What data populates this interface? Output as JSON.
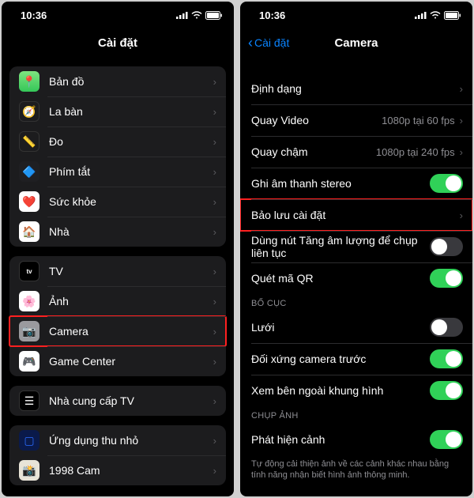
{
  "status": {
    "time": "10:36"
  },
  "left": {
    "title": "Cài đặt",
    "groups": [
      {
        "items": [
          {
            "icon": "maps-icon",
            "label": "Bản đồ"
          },
          {
            "icon": "compass-icon",
            "label": "La bàn"
          },
          {
            "icon": "measure-icon",
            "label": "Đo"
          },
          {
            "icon": "shortcuts-icon",
            "label": "Phím tắt"
          },
          {
            "icon": "health-icon",
            "label": "Sức khỏe"
          },
          {
            "icon": "home-icon",
            "label": "Nhà"
          }
        ]
      },
      {
        "items": [
          {
            "icon": "tv-icon",
            "label": "TV"
          },
          {
            "icon": "photos-icon",
            "label": "Ảnh"
          },
          {
            "icon": "camera-icon",
            "label": "Camera",
            "highlight": true
          },
          {
            "icon": "gamecenter-icon",
            "label": "Game Center"
          }
        ]
      },
      {
        "items": [
          {
            "icon": "tvprovider-icon",
            "label": "Nhà cung cấp TV"
          }
        ]
      },
      {
        "items": [
          {
            "icon": "widget-icon",
            "label": "Ứng dụng thu nhỏ"
          },
          {
            "icon": "cam1998-icon",
            "label": "1998 Cam"
          }
        ]
      }
    ]
  },
  "right": {
    "back": "Cài đặt",
    "title": "Camera",
    "section1": [
      {
        "label": "Định dạng",
        "type": "nav"
      },
      {
        "label": "Quay Video",
        "detail": "1080p tại 60 fps",
        "type": "nav"
      },
      {
        "label": "Quay chậm",
        "detail": "1080p tại 240 fps",
        "type": "nav"
      },
      {
        "label": "Ghi âm thanh stereo",
        "type": "toggle",
        "on": true
      },
      {
        "label": "Bảo lưu cài đặt",
        "type": "nav",
        "highlight": true
      },
      {
        "label": "Dùng nút Tăng âm lượng để chụp liên tục",
        "type": "toggle",
        "on": false
      },
      {
        "label": "Quét mã QR",
        "type": "toggle",
        "on": true
      }
    ],
    "section2_header": "BỐ CỤC",
    "section2": [
      {
        "label": "Lưới",
        "type": "toggle",
        "on": false
      },
      {
        "label": "Đối xứng camera trước",
        "type": "toggle",
        "on": true
      },
      {
        "label": "Xem bên ngoài khung hình",
        "type": "toggle",
        "on": true
      }
    ],
    "section3_header": "CHỤP ẢNH",
    "section3": [
      {
        "label": "Phát hiện cảnh",
        "type": "toggle",
        "on": true
      }
    ],
    "footer": "Tự động cải thiện ảnh về các cảnh khác nhau bằng tính năng nhận biết hình ảnh thông minh."
  }
}
